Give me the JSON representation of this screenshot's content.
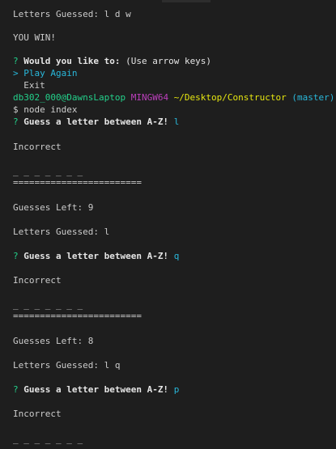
{
  "terminal": {
    "lines": {
      "letters_guessed_1": "Letters Guessed: l d w",
      "you_win": "YOU WIN!",
      "prompt_q": "?",
      "prompt_question": "Would you like to:",
      "prompt_hint": "(Use arrow keys)",
      "option_pointer": ">",
      "option_play_again": "Play Again",
      "option_exit": "Exit",
      "user_host": "db302_000@DawnsLaptop",
      "shell": "MINGW64",
      "path": "~/Desktop/Constructor",
      "branch": "(master)",
      "shell_prompt": "$",
      "command": "node index",
      "guess_q": "?",
      "guess_label": "Guess a letter between A-Z!",
      "guess_answer_1": "l",
      "incorrect_1": "Incorrect",
      "blanks_1": "_ _ _ _ _ _ _",
      "divider_1": "========================",
      "guesses_left_1": "Guesses Left: 9",
      "letters_guessed_2": "Letters Guessed: l",
      "guess_answer_2": "q",
      "incorrect_2": "Incorrect",
      "blanks_2": "_ _ _ _ _ _ _",
      "divider_2": "========================",
      "guesses_left_2": "Guesses Left: 8",
      "letters_guessed_3": "Letters Guessed: l q",
      "guess_answer_3": "p",
      "incorrect_3": "Incorrect",
      "blanks_3": "_ _ _ _ _ _ _"
    },
    "colors": {
      "background": "#1e1e1e",
      "text": "#cccccc",
      "prompt_green": "#23d18b",
      "answer_cyan": "#29b8db",
      "shell_magenta": "#bc3fbc",
      "path_yellow": "#e5e510"
    }
  }
}
